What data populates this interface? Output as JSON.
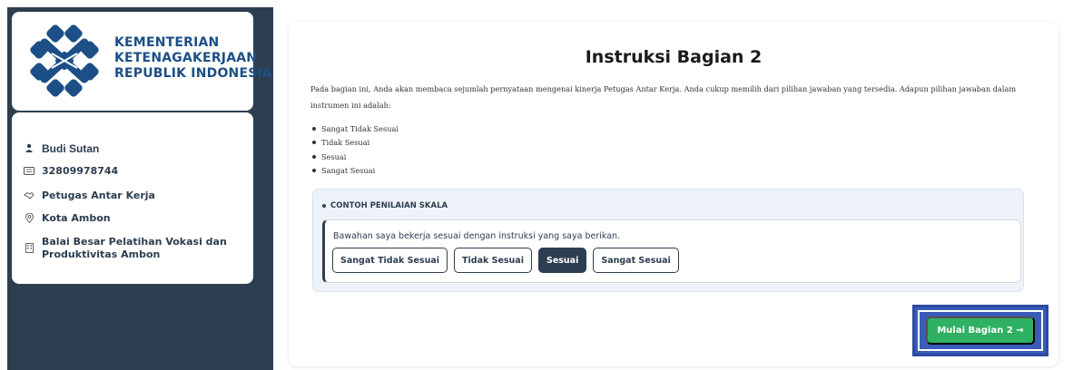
{
  "sidebar": {
    "logo_lines": [
      "KEMENTERIAN",
      "KETENAGAKERJAAN",
      "REPUBLIK INDONESIA"
    ],
    "brand_color": "#1c4f86",
    "profile": {
      "name": "Budi Sutan",
      "id_number": "32809978744",
      "role": "Petugas Antar Kerja",
      "city": "Kota Ambon",
      "office": "Balai Besar Pelatihan Vokasi dan Produktivitas Ambon"
    },
    "icons": [
      "user-icon",
      "id-card-icon",
      "handshake-icon",
      "location-pin-icon",
      "building-icon"
    ]
  },
  "main": {
    "title": "Instruksi Bagian 2",
    "description": "Pada bagian ini, Anda akan membaca sejumlah pernyataan mengenai kinerja Petugas Antar Kerja. Anda cukup memilih dari pilihan jawaban yang tersedia. Adapun pilihan jawaban dalam instrumen ini adalah:",
    "options": [
      "Sangat Tidak Sesuai",
      "Tidak Sesuai",
      "Sesuai",
      "Sangat Sesuai"
    ],
    "example": {
      "heading": "CONTOH PENILAIAN SKALA",
      "statement": "Bawahan saya bekerja sesuai dengan instruksi yang saya berikan.",
      "choices": [
        "Sangat Tidak Sesuai",
        "Tidak Sesuai",
        "Sesuai",
        "Sangat Sesuai"
      ],
      "selected": "Sesuai"
    },
    "start_button": "Mulai Bagian 2 →"
  },
  "colors": {
    "sidebar_bg": "#2d3e50",
    "primary_green": "#2fb163",
    "highlight_frame": "#2b4aa0"
  }
}
